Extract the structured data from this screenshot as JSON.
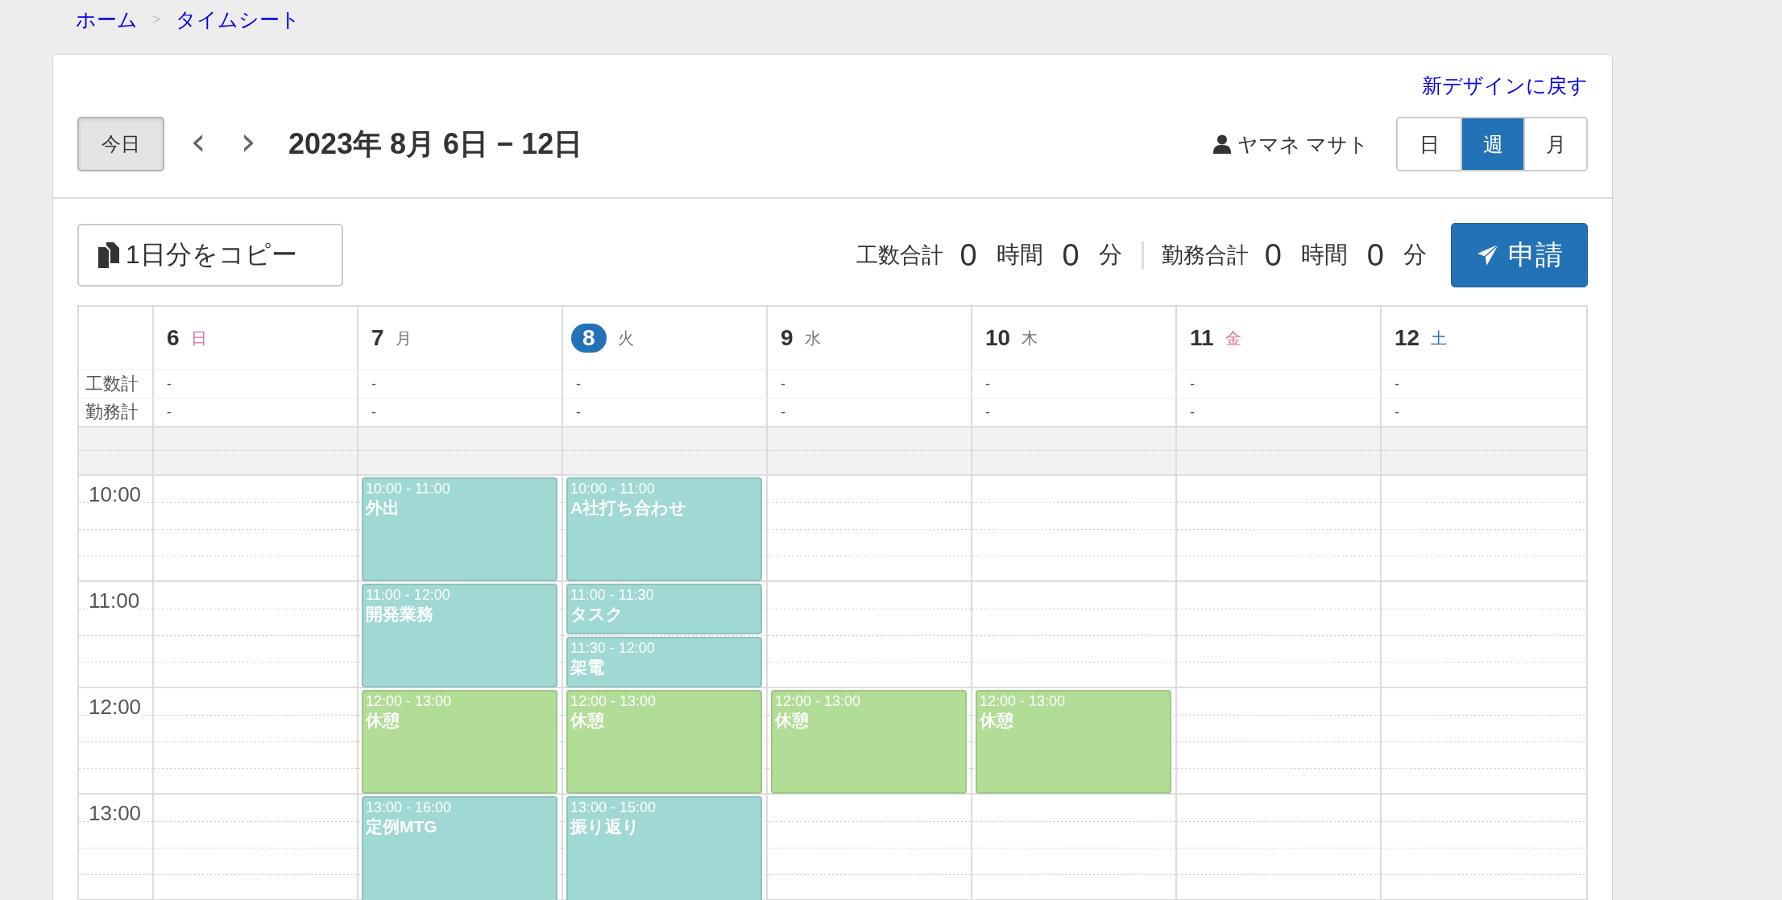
{
  "breadcrumb": [
    {
      "label": "ホーム"
    },
    {
      "label": "タイムシート"
    }
  ],
  "breadcrumb_separator": ">",
  "back_link": "新デザインに戻す",
  "toolbar": {
    "today_button": "今日",
    "prev": "‹",
    "next": "›",
    "range_title": "2023年 8月 6日 − 12日",
    "user": "ヤマネ マサト",
    "views": [
      {
        "label": "日",
        "selected": false
      },
      {
        "label": "週",
        "selected": true
      },
      {
        "label": "月",
        "selected": false
      }
    ]
  },
  "copy_button": "1日分をコピー",
  "totals": [
    {
      "label": "工数合計",
      "hours": "0",
      "hours_unit": "時間",
      "minutes": "0",
      "minutes_unit": "分"
    },
    {
      "label": "勤務合計",
      "hours": "0",
      "hours_unit": "時間",
      "minutes": "0",
      "minutes_unit": "分"
    }
  ],
  "submit_button": "申請",
  "row_labels": [
    "工数計",
    "勤務計"
  ],
  "hours": [
    "10:00",
    "11:00",
    "12:00",
    "13:00"
  ],
  "days": [
    {
      "date": "6",
      "weekday": "日",
      "kind": "holiday",
      "today": false,
      "man_hours": "-",
      "work_hours": "-"
    },
    {
      "date": "7",
      "weekday": "月",
      "kind": "weekday",
      "today": false,
      "man_hours": "-",
      "work_hours": "-",
      "events": [
        {
          "time": "10:00 - 11:00",
          "title": "外出",
          "color": "#a0d8d3"
        },
        {
          "time": "11:00 - 12:00",
          "title": "開発業務",
          "color": "#a0d8d3"
        },
        {
          "time": "12:00 - 13:00",
          "title": "休憩",
          "color": "#b1dd96"
        },
        {
          "time": "13:00 - 16:00",
          "title": "定例MTG",
          "color": "#a0d8d3"
        }
      ]
    },
    {
      "date": "8",
      "weekday": "火",
      "kind": "weekday",
      "today": true,
      "man_hours": "-",
      "work_hours": "-",
      "events": [
        {
          "time": "10:00 - 11:00",
          "title": "A社打ち合わせ",
          "color": "#a0d8d3"
        },
        {
          "time": "11:00 - 11:30",
          "title": "タスク",
          "color": "#a0d8d3"
        },
        {
          "time": "11:30 - 12:00",
          "title": "架電",
          "color": "#a0d8d3"
        },
        {
          "time": "12:00 - 13:00",
          "title": "休憩",
          "color": "#b1dd96"
        },
        {
          "time": "13:00 - 15:00",
          "title": "振り返り",
          "color": "#a0d8d3"
        }
      ]
    },
    {
      "date": "9",
      "weekday": "水",
      "kind": "weekday",
      "today": false,
      "man_hours": "-",
      "work_hours": "-",
      "events": [
        {
          "time": "12:00 - 13:00",
          "title": "休憩",
          "color": "#b1dd96"
        }
      ]
    },
    {
      "date": "10",
      "weekday": "木",
      "kind": "weekday",
      "today": false,
      "man_hours": "-",
      "work_hours": "-",
      "events": [
        {
          "time": "12:00 - 13:00",
          "title": "休憩",
          "color": "#b1dd96"
        }
      ]
    },
    {
      "date": "11",
      "weekday": "金",
      "kind": "holiday",
      "today": false,
      "man_hours": "-",
      "work_hours": "-"
    },
    {
      "date": "12",
      "weekday": "土",
      "kind": "saturday",
      "today": false,
      "man_hours": "-",
      "work_hours": "-"
    }
  ]
}
